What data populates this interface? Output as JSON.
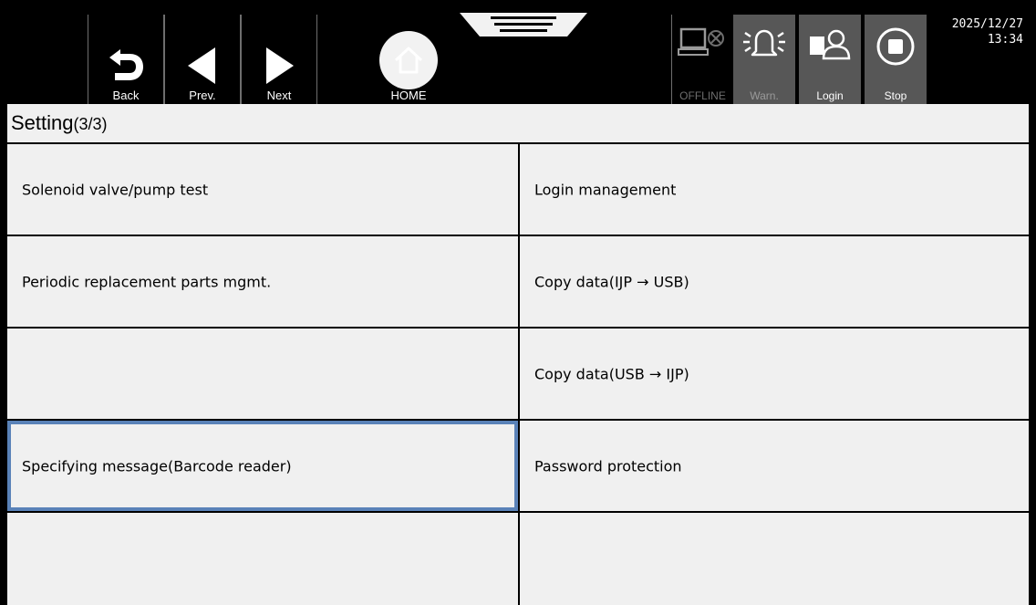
{
  "toolbar": {
    "back_label": "Back",
    "prev_label": "Prev.",
    "next_label": "Next",
    "home_label": "HOME"
  },
  "status": {
    "offline_label": "OFFLINE",
    "warn_label": "Warn.",
    "login_label": "Login",
    "stop_label": "Stop",
    "date": "2025/12/27",
    "time": "13:34"
  },
  "page": {
    "title": "Setting",
    "page_indicator": "(3/3)"
  },
  "menu": {
    "left": [
      "Solenoid valve/pump test",
      "Periodic replacement parts mgmt.",
      "",
      "Specifying message(Barcode reader)",
      ""
    ],
    "right": [
      "Login management",
      "Copy data(IJP → USB)",
      "Copy data(USB → IJP)",
      "Password protection",
      ""
    ],
    "selected": "Specifying message(Barcode reader)"
  },
  "colors": {
    "selection_outline": "#5a82b8",
    "panel_background": "#f0f0f0",
    "status_button_background": "#575757"
  }
}
